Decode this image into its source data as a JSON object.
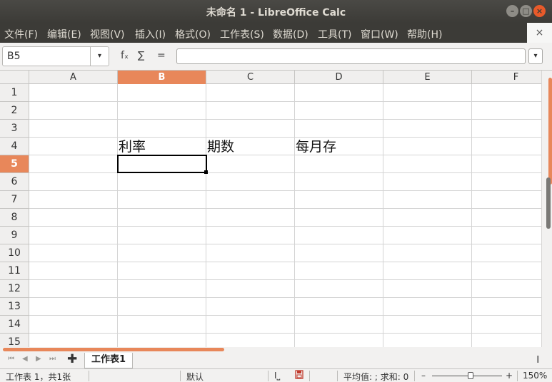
{
  "window": {
    "title": "未命名 1 - LibreOffice Calc",
    "min_glyph": "–",
    "max_glyph": "□",
    "close_glyph": "×"
  },
  "menu": [
    {
      "label": "文件(F)"
    },
    {
      "label": "编辑(E)"
    },
    {
      "label": "视图(V)"
    },
    {
      "label": "插入(I)"
    },
    {
      "label": "格式(O)"
    },
    {
      "label": "工作表(S)"
    },
    {
      "label": "数据(D)"
    },
    {
      "label": "工具(T)"
    },
    {
      "label": "窗口(W)"
    },
    {
      "label": "帮助(H)"
    }
  ],
  "doc_close_glyph": "×",
  "formula_bar": {
    "name_box": "B5",
    "dropdown_glyph": "▾",
    "fx_glyph": "fₓ",
    "sum_glyph": "∑",
    "equals_glyph": "=",
    "input_value": "",
    "expand_glyph": "▾"
  },
  "columns": [
    "A",
    "B",
    "C",
    "D",
    "E",
    "F"
  ],
  "active_column": "B",
  "rows": [
    "1",
    "2",
    "3",
    "4",
    "5",
    "6",
    "7",
    "8",
    "9",
    "10",
    "11",
    "12",
    "13",
    "14",
    "15"
  ],
  "active_row": "5",
  "cells": {
    "B4": "利率",
    "C4": "期数",
    "D4": "每月存"
  },
  "sheet_tabs": {
    "add_glyph": "✚",
    "nav_glyphs": [
      "⏮",
      "◀",
      "▶",
      "⏭"
    ],
    "tabs": [
      "工作表1"
    ]
  },
  "status_bar": {
    "sheet_info": "工作表 1，共1张",
    "page_style": "默认",
    "insert_mode": "I⎵",
    "summary": "平均值: ; 求和: 0",
    "zoom_minus": "–",
    "zoom_plus": "+",
    "zoom": "150%"
  },
  "colors": {
    "accent": "#e8875a",
    "titlebar": "#3c3b37",
    "close_button": "#e85a2a"
  }
}
